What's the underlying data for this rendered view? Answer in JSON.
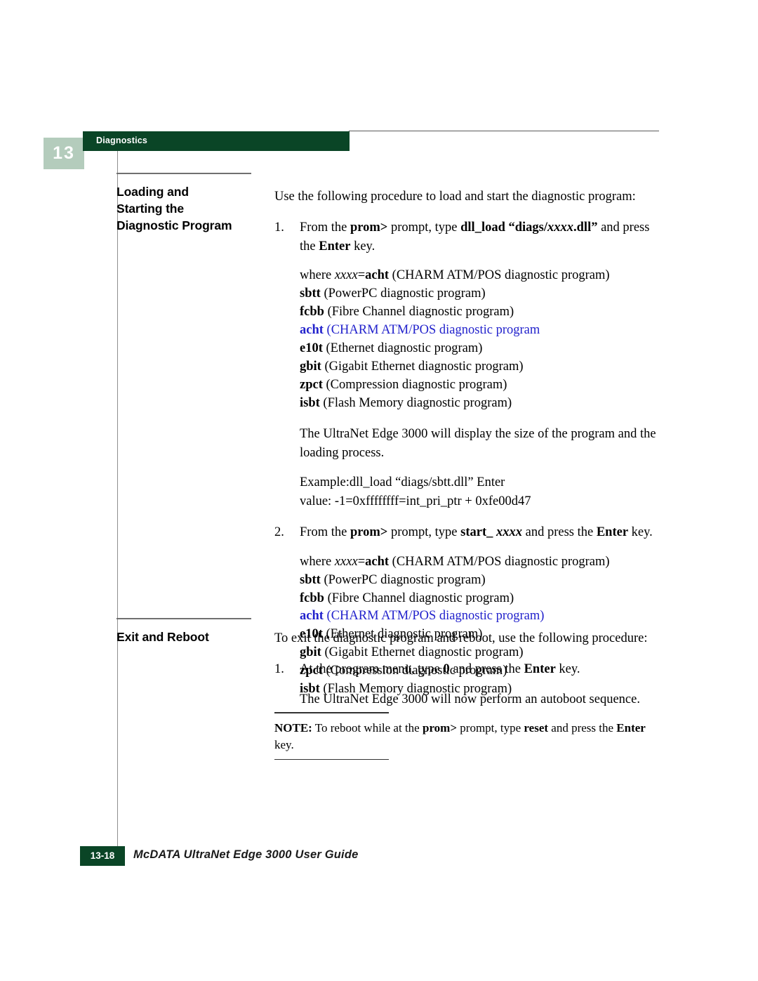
{
  "header": {
    "chapter_number": "13",
    "running_head": "Diagnostics",
    "band_color": "#0a4526",
    "tab_color": "#b4ccbc"
  },
  "sections": [
    {
      "heading": "Loading and\nStarting the\nDiagnostic Program",
      "heading_line1": "Loading and",
      "heading_line2": "Starting the",
      "heading_line3": "Diagnostic Program"
    },
    {
      "heading": "Exit and Reboot"
    }
  ],
  "loading_section": {
    "intro": "Use the following procedure to load and start the diagnostic program:",
    "step1": {
      "number": "1.",
      "text_a": "From the ",
      "bold_prom": "prom>",
      "text_b": " prompt, type ",
      "bold_cmd": "dll_load “diags/",
      "italic_xxxx": "xxxx",
      "bold_cmd_end": ".dll”",
      "text_c": " and press the ",
      "bold_enter": "Enter",
      "text_d": " key."
    },
    "where_prefix": "where ",
    "where_italic": "xxxx",
    "where_eq": "=",
    "program_list": [
      {
        "code": "acht",
        "desc": " (CHARM ATM/POS diagnostic program)",
        "first": true,
        "blue": false
      },
      {
        "code": "sbtt",
        "desc": " (PowerPC diagnostic program)",
        "blue": false
      },
      {
        "code": "fcbb",
        "desc": " (Fibre Channel diagnostic program)",
        "blue": false
      },
      {
        "code": "acht",
        "desc": " (CHARM ATM/POS diagnostic program",
        "blue": true
      },
      {
        "code": "e10t",
        "desc": " (Ethernet diagnostic program)",
        "blue": false
      },
      {
        "code": "gbit",
        "desc": " (Gigabit Ethernet diagnostic program)",
        "blue": false
      },
      {
        "code": "zpct",
        "desc": " (Compression diagnostic program)",
        "blue": false
      },
      {
        "code": "isbt",
        "desc": " (Flash Memory diagnostic program)",
        "blue": false
      }
    ],
    "display_para": "The UltraNet Edge 3000 will display the size of the program and the loading process.",
    "example_line1": "Example:dll_load “diags/sbtt.dll” Enter",
    "example_line2": "value: -1=0xffffffff=int_pri_ptr + 0xfe00d47",
    "step2": {
      "number": "2.",
      "text_a": "From the ",
      "bold_prom": "prom>",
      "text_b": " prompt, type ",
      "bold_cmd": "start_ ",
      "italic_xxxx": "xxxx",
      "text_c": " and press the ",
      "bold_enter": "Enter",
      "text_d": " key."
    },
    "program_list2": [
      {
        "code": "acht",
        "desc": " (CHARM ATM/POS diagnostic program)",
        "first": true,
        "blue": false
      },
      {
        "code": "sbtt",
        "desc": " (PowerPC diagnostic program)",
        "blue": false
      },
      {
        "code": "fcbb",
        "desc": " (Fibre Channel diagnostic program)",
        "blue": false
      },
      {
        "code": "acht",
        "desc": " (CHARM ATM/POS diagnostic program)",
        "blue": true
      },
      {
        "code": "e10t",
        "desc": " (Ethernet diagnostic program)",
        "blue": false
      },
      {
        "code": "gbit",
        "desc": " (Gigabit Ethernet diagnostic program)",
        "blue": false
      },
      {
        "code": "zpct",
        "desc": " (Compression diagnostic program)",
        "blue": false
      },
      {
        "code": "isbt",
        "desc": " (Flash Memory diagnostic program)",
        "blue": false
      }
    ]
  },
  "exit_section": {
    "intro": "To exit the diagnostic program and reboot, use the following procedure:",
    "step1": {
      "number": "1.",
      "text_a": "At the program menu, type ",
      "bold_zero": "0",
      "text_b": " and press the ",
      "bold_enter": "Enter",
      "text_c": " key."
    },
    "autoboot": "The UltraNet Edge 3000 will now perform an autoboot sequence."
  },
  "note": {
    "label": "NOTE:",
    "text_a": " To reboot while at the ",
    "bold_prom": "prom>",
    "text_b": " prompt, type ",
    "bold_reset": "reset",
    "text_c": " and press the ",
    "bold_enter": "Enter",
    "text_d": " key."
  },
  "footer": {
    "page_number": "13-18",
    "title": "McDATA UltraNet Edge 3000 User Guide"
  },
  "colors": {
    "brand_green": "#0a4526",
    "tab_sage": "#b4ccbc",
    "highlight_blue": "#2222cc"
  }
}
